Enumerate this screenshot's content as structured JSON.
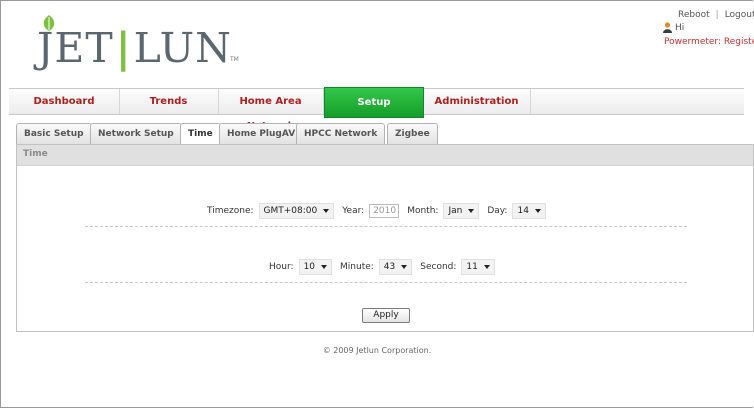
{
  "header": {
    "logo_text_left": "JET",
    "logo_bar": "|",
    "logo_text_right": "LUN",
    "logo_tm": "TM",
    "reboot": "Reboot",
    "separator": "|",
    "logout": "Logout",
    "greeting": "Hi",
    "powermeter_label": "Powermeter:",
    "powermeter_status": "Registere"
  },
  "mainnav": {
    "items": [
      {
        "label": "Dashboard"
      },
      {
        "label": "Trends"
      },
      {
        "label": "Home Area Network"
      },
      {
        "label": "Setup"
      },
      {
        "label": "Administration"
      }
    ],
    "active_index": 3,
    "active_color": "#22b33b",
    "label_color": "#b01e1e"
  },
  "subtabs": {
    "items": [
      {
        "label": "Basic Setup"
      },
      {
        "label": "Network Setup"
      },
      {
        "label": "Time"
      },
      {
        "label": "Home PlugAV"
      },
      {
        "label": "HPCC Network"
      },
      {
        "label": "Zigbee"
      }
    ],
    "active_index": 2
  },
  "panel": {
    "title": "Time",
    "timezone_label": "Timezone:",
    "timezone_value": "GMT+08:00",
    "year_label": "Year:",
    "year_value": "2010",
    "month_label": "Month:",
    "month_value": "Jan",
    "day_label": "Day:",
    "day_value": "14",
    "hour_label": "Hour:",
    "hour_value": "10",
    "minute_label": "Minute:",
    "minute_value": "43",
    "second_label": "Second:",
    "second_value": "11",
    "apply_label": "Apply"
  },
  "footer": {
    "copyright": "© 2009 Jetlun Corporation."
  }
}
